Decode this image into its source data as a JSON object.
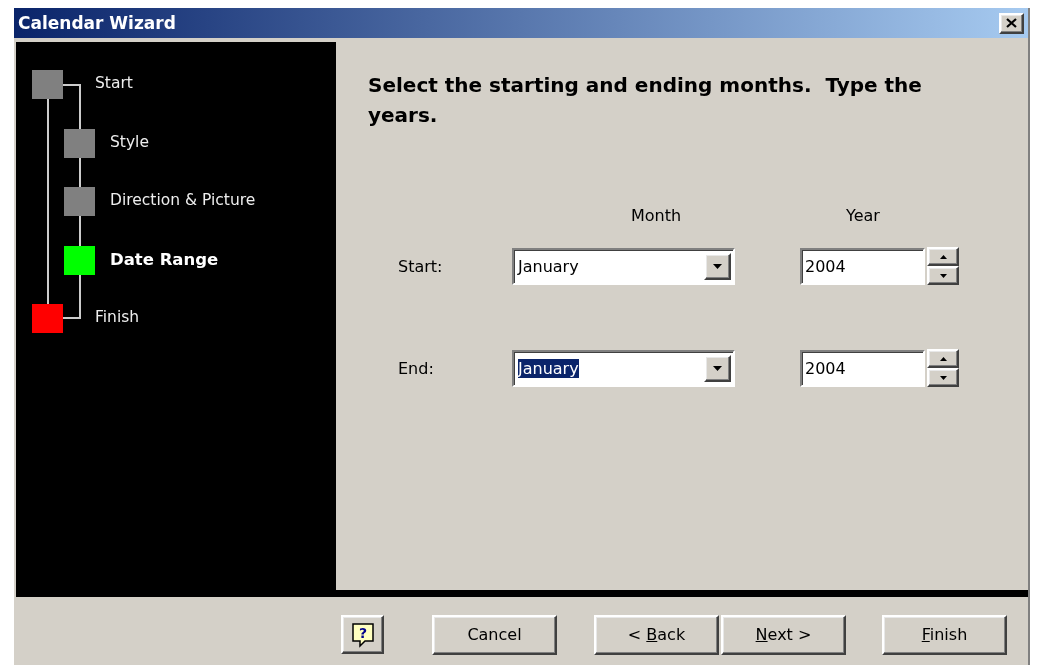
{
  "window": {
    "title": "Calendar Wizard"
  },
  "steps": [
    {
      "label": "Start",
      "color": "#808080",
      "selected": false,
      "children": [
        {
          "label": "Style",
          "color": "#808080",
          "selected": false
        },
        {
          "label": "Direction & Picture",
          "color": "#808080",
          "selected": false
        },
        {
          "label": "Date Range",
          "color": "#00ff00",
          "selected": true
        }
      ]
    },
    {
      "label": "Finish",
      "color": "#ff0000",
      "selected": false
    }
  ],
  "instruction": "Select the starting and ending months.  Type the years.",
  "column_headers": [
    "Month",
    "Year"
  ],
  "rows": [
    {
      "label": "Start:",
      "month": "January",
      "month_selected": false,
      "year": "2004"
    },
    {
      "label": "End:",
      "month": "January",
      "month_selected": true,
      "year": "2004"
    }
  ],
  "buttons": [
    {
      "kind": "help",
      "glyph": "?"
    },
    {
      "kind": "text",
      "label": "Cancel"
    },
    {
      "kind": "text",
      "before": "< ",
      "key": "B",
      "after": "ack"
    },
    {
      "kind": "text",
      "key": "N",
      "after": "ext >"
    },
    {
      "kind": "text",
      "key": "F",
      "after": "inish"
    }
  ]
}
